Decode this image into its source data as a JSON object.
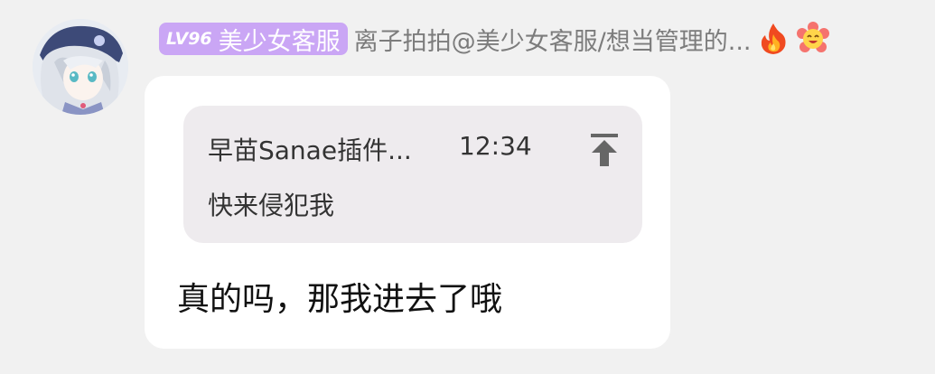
{
  "sender": {
    "level": "LV96",
    "title": "美少女客服",
    "nickname": "离子拍拍@美少女客服/想当管理的...",
    "badge_color": "#caa6f5",
    "status_icons": [
      "fire-icon",
      "smiling-flower-icon"
    ]
  },
  "message": {
    "reply": {
      "name": "早苗Sanae插件...",
      "time": "12:34",
      "text": "快来侵犯我",
      "jump_icon": "scroll-to-top-icon"
    },
    "text": "真的吗，那我进去了哦"
  }
}
